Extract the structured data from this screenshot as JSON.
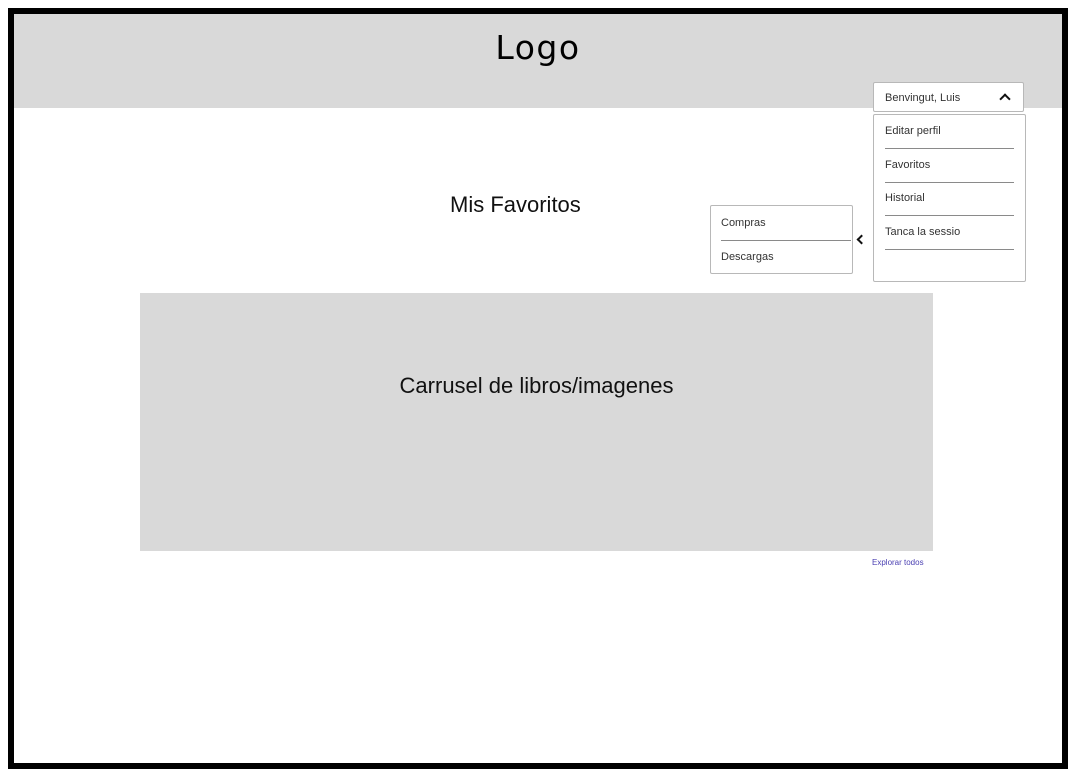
{
  "header": {
    "logo": "Logo"
  },
  "user_dropdown": {
    "selected_label": "Benvingut, Luis",
    "items": [
      {
        "label": "Editar perfil"
      },
      {
        "label": "Favoritos"
      },
      {
        "label": "Historial"
      },
      {
        "label": "Tanca la sessio"
      }
    ]
  },
  "submenu": {
    "items": [
      {
        "label": "Compras"
      },
      {
        "label": "Descargas"
      }
    ]
  },
  "main": {
    "title": "Mis Favoritos",
    "carousel_label": "Carrusel de libros/imagenes",
    "explore_link": "Explorar todos"
  },
  "colors": {
    "header_bg": "#d9d9d9",
    "carousel_bg": "#d9d9d9",
    "link": "#4a3fb2",
    "frame_border": "#000000"
  }
}
